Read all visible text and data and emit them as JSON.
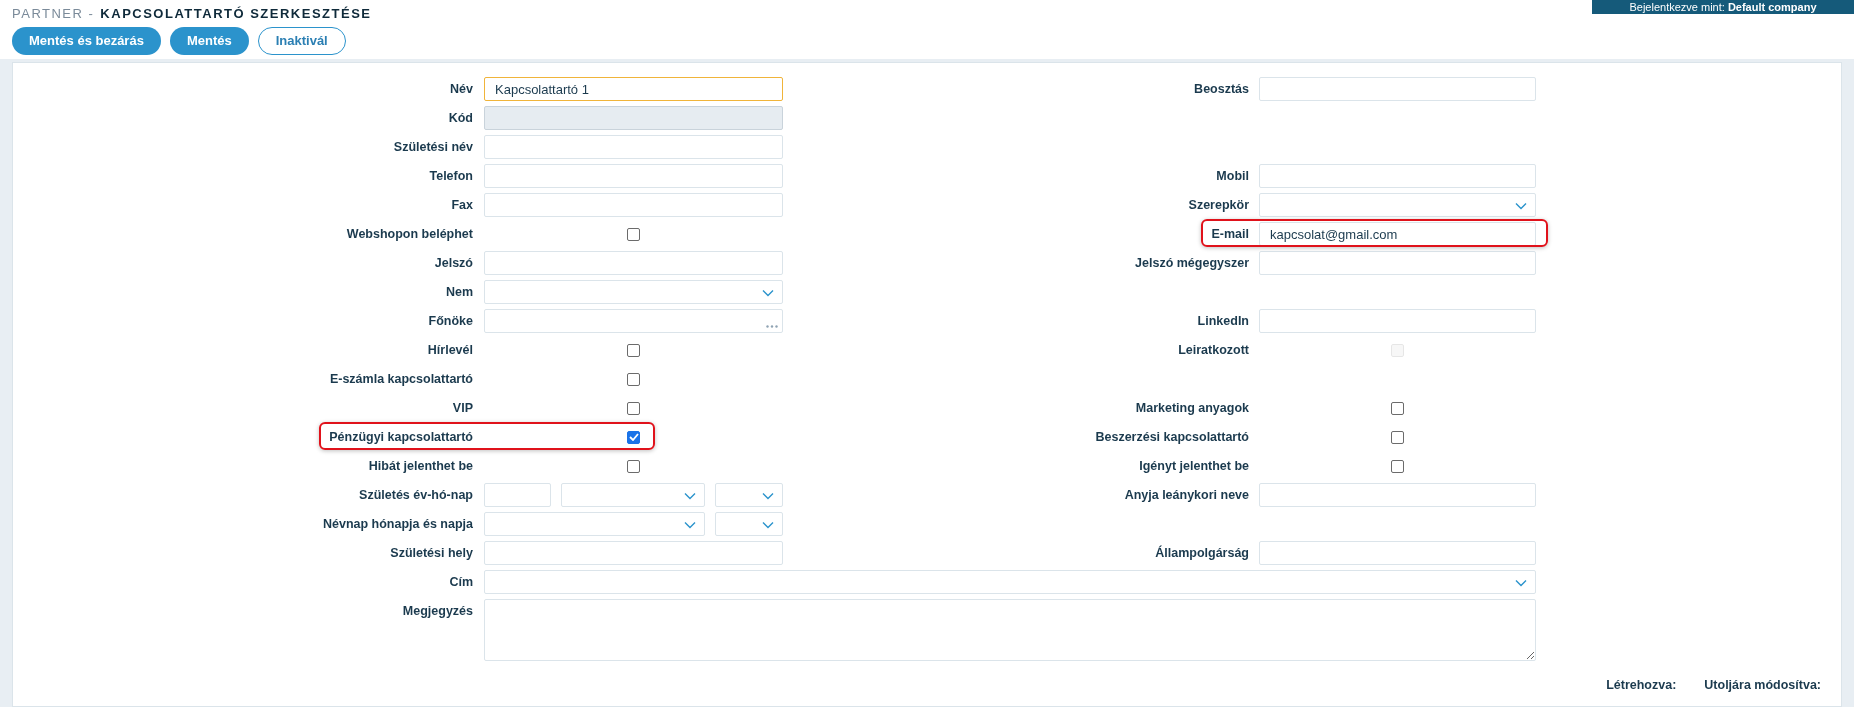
{
  "login": "Bejelentkezve mint: **Default company**",
  "header": {
    "section": "PARTNER -",
    "title": "KAPCSOLATTARTÓ SZERKESZTÉSE"
  },
  "buttons": [
    {
      "label": "Mentés és bezárás",
      "kind": "primary"
    },
    {
      "label": "Mentés",
      "kind": "primary"
    },
    {
      "label": "Inaktivál",
      "kind": "outline"
    }
  ],
  "rows": [
    {
      "left": {
        "kind": "text",
        "label": "Név",
        "value": "Kapcsolattartó 1",
        "focused": true,
        "disabled": false
      },
      "right": {
        "kind": "text",
        "label": "Beosztás",
        "focused": false,
        "disabled": false
      }
    },
    {
      "left": {
        "kind": "text",
        "label": "Kód",
        "focused": false,
        "disabled": true
      }
    },
    {
      "left": {
        "kind": "text",
        "label": "Születési név",
        "focused": false,
        "disabled": false
      }
    },
    {
      "left": {
        "kind": "text",
        "label": "Telefon",
        "focused": false,
        "disabled": false
      },
      "right": {
        "kind": "text",
        "label": "Mobil",
        "focused": false,
        "disabled": false
      }
    },
    {
      "left": {
        "kind": "text",
        "label": "Fax",
        "focused": false,
        "disabled": false
      },
      "right": {
        "kind": "select",
        "label": "Szerepkör"
      }
    },
    {
      "left": {
        "kind": "checkbox",
        "label": "Webshopon beléphet",
        "checked": false,
        "disabled": false
      },
      "right": {
        "kind": "text",
        "label": "E-mail",
        "value": "kapcsolat@gmail.com",
        "focused": false,
        "disabled": false,
        "highlighted": true
      }
    },
    {
      "left": {
        "kind": "text",
        "label": "Jelszó",
        "focused": false,
        "disabled": false
      },
      "right": {
        "kind": "text",
        "label": "Jelszó mégegyszer",
        "focused": false,
        "disabled": false
      }
    },
    {
      "left": {
        "kind": "select",
        "label": "Nem"
      }
    },
    {
      "left": {
        "kind": "lookup",
        "label": "Főnöke"
      },
      "right": {
        "kind": "text",
        "label": "LinkedIn",
        "focused": false,
        "disabled": false
      }
    },
    {
      "left": {
        "kind": "checkbox",
        "label": "Hírlevél",
        "checked": false,
        "disabled": false
      },
      "right": {
        "kind": "checkbox",
        "label": "Leiratkozott",
        "checked": false,
        "disabled": true
      }
    },
    {
      "left": {
        "kind": "checkbox",
        "label": "E-számla kapcsolattartó",
        "checked": false,
        "disabled": false
      }
    },
    {
      "left": {
        "kind": "checkbox",
        "label": "VIP",
        "checked": false,
        "disabled": false
      },
      "right": {
        "kind": "checkbox",
        "label": "Marketing anyagok",
        "checked": false,
        "disabled": false
      }
    },
    {
      "left": {
        "kind": "checkbox",
        "label": "Pénzügyi kapcsolattartó",
        "checked": true,
        "disabled": false,
        "highlighted": true
      },
      "right": {
        "kind": "checkbox",
        "label": "Beszerzési kapcsolattartó",
        "checked": false,
        "disabled": false
      }
    },
    {
      "left": {
        "kind": "checkbox",
        "label": "Hibát jelenthet be",
        "checked": false,
        "disabled": false
      },
      "right": {
        "kind": "checkbox",
        "label": "Igényt jelenthet be",
        "checked": false,
        "disabled": false
      }
    },
    {
      "left": {
        "kind": "date3",
        "label": "Születés év-hó-nap"
      },
      "right": {
        "kind": "text",
        "label": "Anyja leánykori neve",
        "focused": false,
        "disabled": false
      }
    },
    {
      "left": {
        "kind": "date2",
        "label": "Névnap hónapja és napja"
      }
    },
    {
      "left": {
        "kind": "text",
        "label": "Születési hely",
        "focused": false,
        "disabled": false
      },
      "right": {
        "kind": "text",
        "label": "Állampolgárság",
        "focused": false,
        "disabled": false
      }
    },
    {
      "left": {
        "kind": "wide_select",
        "label": "Cím"
      }
    },
    {
      "left": {
        "kind": "textarea",
        "label": "Megjegyzés"
      }
    }
  ],
  "footer": [
    "Létrehozva:",
    "Utoljára módosítva:"
  ]
}
